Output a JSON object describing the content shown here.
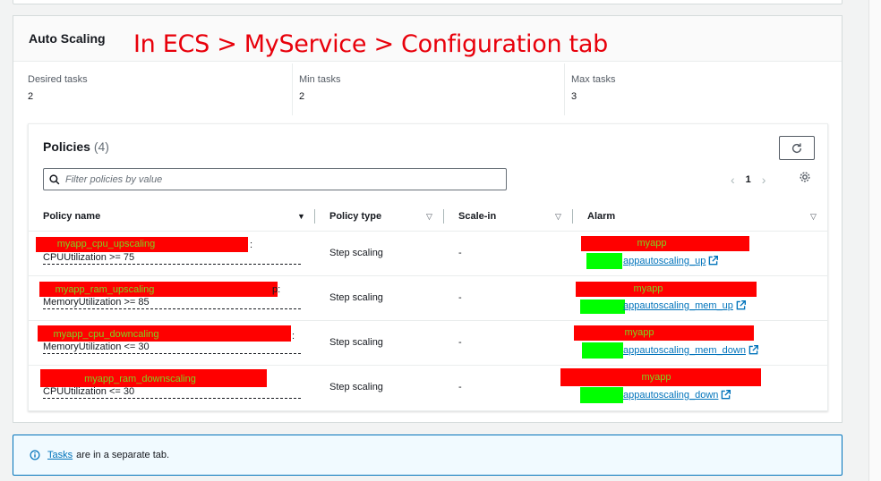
{
  "card": {
    "title": "Auto Scaling",
    "annotation": "In ECS > MyService > Configuration tab"
  },
  "tasks": {
    "desired_label": "Desired tasks",
    "desired_value": "2",
    "min_label": "Min tasks",
    "min_value": "2",
    "max_label": "Max tasks",
    "max_value": "3"
  },
  "policies": {
    "title": "Policies",
    "count": "(4)",
    "search_placeholder": "Filter policies by value",
    "page": "1",
    "columns": {
      "name": "Policy name",
      "type": "Policy type",
      "scalein": "Scale-in",
      "alarm": "Alarm"
    },
    "rows": [
      {
        "name": "myapp_cpu_upscaling",
        "name_suffix": ":",
        "metric": "CPUUtilization >= 75",
        "type": "Step scaling",
        "scalein": "-",
        "alarm_name": "myapp",
        "alarm_link": "appautoscaling_up"
      },
      {
        "name": "myapp_ram_upscaling",
        "name_suffix": "p:",
        "metric": "MemoryUtilization >= 85",
        "type": "Step scaling",
        "scalein": "-",
        "alarm_name": "myapp",
        "alarm_link": "appautoscaling_mem_up"
      },
      {
        "name": "myapp_cpu_downcaling",
        "name_suffix": ":",
        "metric": "MemoryUtilization <= 30",
        "type": "Step scaling",
        "scalein": "-",
        "alarm_name": "myapp",
        "alarm_link": "appautoscaling_mem_down"
      },
      {
        "name": "myapp_ram_downscaling",
        "name_suffix": "",
        "metric": "CPUUtilization <= 30",
        "type": "Step scaling",
        "scalein": "-",
        "alarm_name": "myapp",
        "alarm_link": "appautoscaling_down"
      }
    ]
  },
  "info": {
    "link": "Tasks",
    "text": "are in a separate tab."
  },
  "colors": {
    "accent": "#0073bb",
    "redaction_red": "#ff0000",
    "redaction_green": "#00ff00",
    "annotation": "#e8000b"
  },
  "icons": {
    "refresh": "refresh-icon",
    "search": "search-icon",
    "settings": "gear-icon",
    "external": "external-link-icon",
    "info": "info-icon"
  }
}
